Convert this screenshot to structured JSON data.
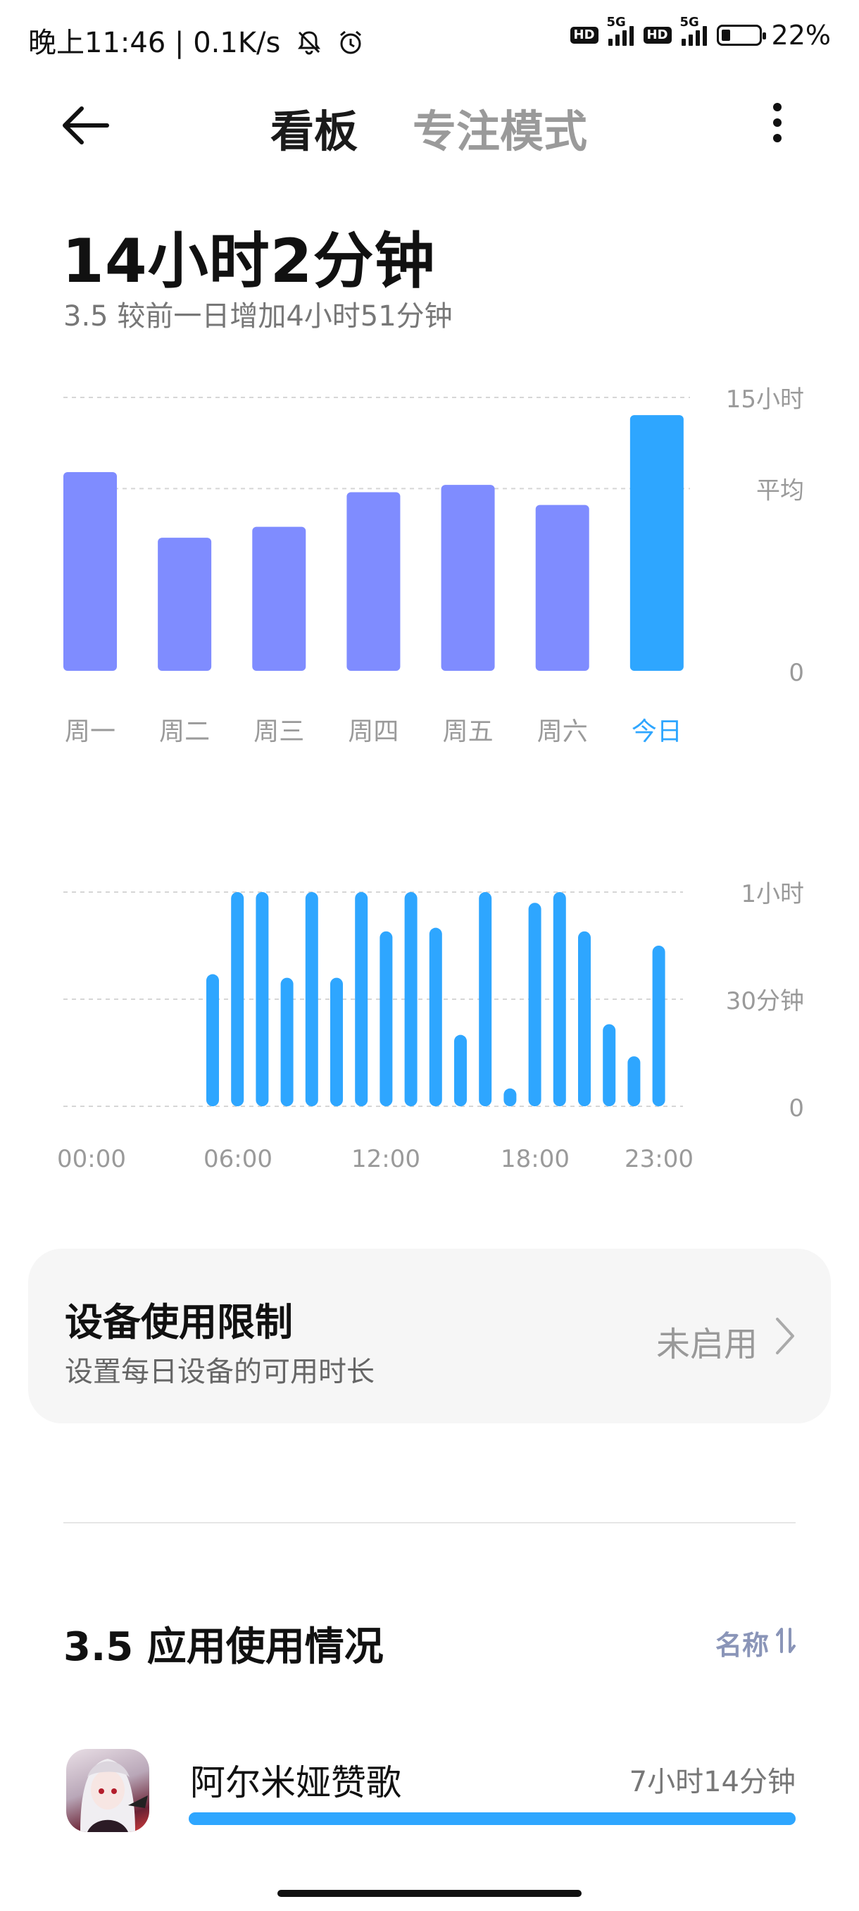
{
  "status_bar": {
    "time": "晚上11:46",
    "speed": "0.1K/s",
    "hd1": "HD",
    "net1": "5G",
    "hd2": "HD",
    "net2": "5G",
    "battery_percent": "22%"
  },
  "nav": {
    "tab_board": "看板",
    "tab_focus": "专注模式"
  },
  "summary": {
    "total": "14小时2分钟",
    "comparison": "3.5  较前一日增加4小时51分钟"
  },
  "colors": {
    "weekday_bar": "#7f8cff",
    "today_bar": "#2ea6ff",
    "hour_bar": "#2ea6ff",
    "accent": "#2ea6ff"
  },
  "chart_data": [
    {
      "type": "bar",
      "name_hint": "weekly",
      "categories": [
        "周一",
        "周二",
        "周三",
        "周四",
        "周五",
        "周六",
        "今日"
      ],
      "values": [
        10.9,
        7.3,
        7.9,
        9.8,
        10.2,
        9.1,
        14.03
      ],
      "ylim": [
        0,
        15
      ],
      "y_tick_labels": [
        {
          "value": 15,
          "label": "15小时"
        },
        {
          "value": 10,
          "label": "平均"
        },
        {
          "value": 0,
          "label": "0"
        }
      ],
      "highlight_category": "今日"
    },
    {
      "type": "bar",
      "name_hint": "hourly",
      "x": [
        6,
        7,
        8,
        9,
        10,
        11,
        12,
        13,
        14,
        15,
        16,
        17,
        18,
        19,
        20,
        21,
        22,
        23
      ],
      "values": [
        37,
        60,
        60,
        36,
        60,
        36,
        60,
        49,
        60,
        50,
        20,
        60,
        5,
        57,
        60,
        49,
        23,
        14,
        45
      ],
      "hours_all": [
        6,
        6.5,
        7,
        8,
        9,
        10,
        11,
        12,
        13,
        14,
        15,
        16,
        17,
        18,
        19,
        20,
        21,
        22,
        23
      ],
      "ylim": [
        0,
        60
      ],
      "y_tick_labels": [
        {
          "value": 60,
          "label": "1小时"
        },
        {
          "value": 30,
          "label": "30分钟"
        },
        {
          "value": 0,
          "label": "0"
        }
      ],
      "x_tick_labels": [
        "00:00",
        "06:00",
        "12:00",
        "18:00",
        "23:00"
      ]
    }
  ],
  "limit_card": {
    "title": "设备使用限制",
    "subtitle": "设置每日设备的可用时长",
    "status": "未启用"
  },
  "usage": {
    "title": "3.5 应用使用情况",
    "sort_label": "名称",
    "sort_icon": "sort-arrows-icon",
    "apps": [
      {
        "name": "阿尔米娅赞歌",
        "time": "7小时14分钟",
        "share": 1.0
      }
    ]
  }
}
